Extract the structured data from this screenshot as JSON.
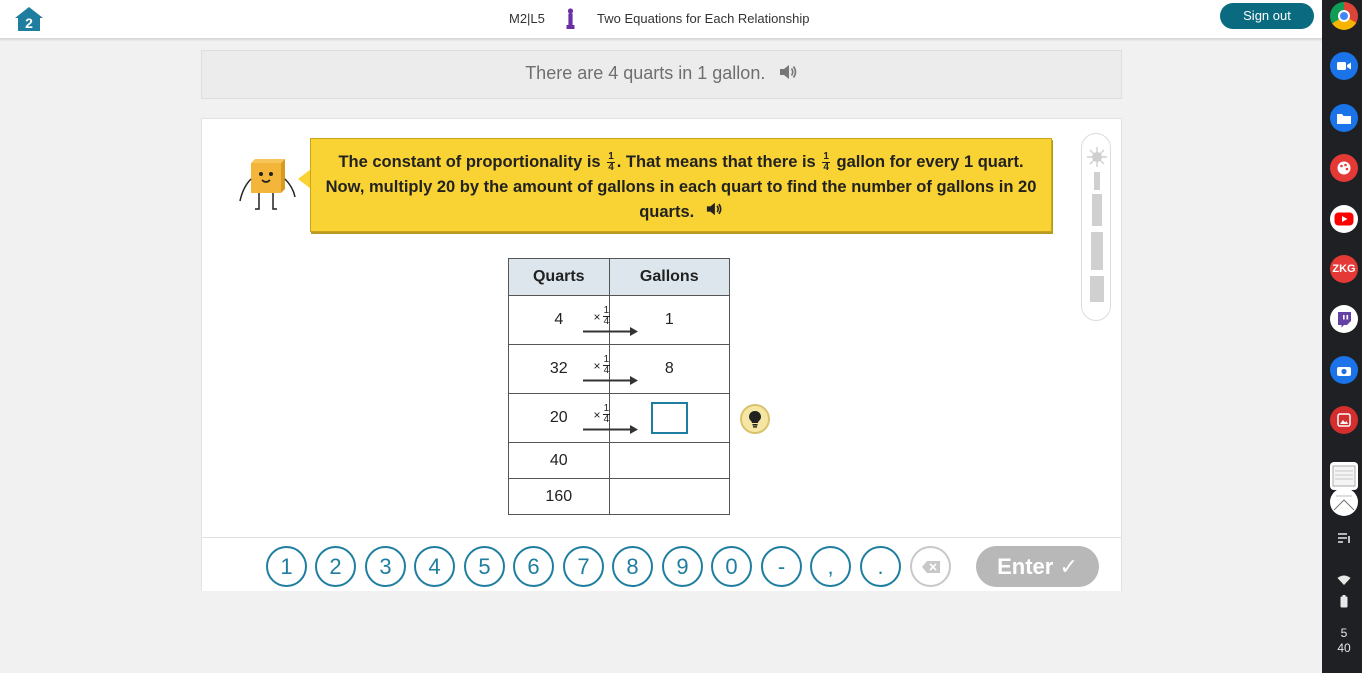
{
  "header": {
    "lesson_code": "M2|L5",
    "lesson_title": "Two Equations for Each Relationship",
    "signout_label": "Sign out",
    "accent_color": "#0a6a80"
  },
  "prompt": {
    "text": "There are 4 quarts in 1 gallon."
  },
  "hint": {
    "part1": "The constant of proportionality is",
    "frac1_num": "1",
    "frac1_den": "4",
    "part2": ". That means that there is",
    "frac2_num": "1",
    "frac2_den": "4",
    "part3": "gallon for every 1 quart. Now, multiply 20 by the amount of gallons in each quart to find the number of gallons in 20 quarts."
  },
  "table": {
    "headers": [
      "Quarts",
      "Gallons"
    ],
    "operator_symbol": "×",
    "operator_num": "1",
    "operator_den": "4",
    "rows": [
      {
        "quarts": "4",
        "gallons": "1"
      },
      {
        "quarts": "32",
        "gallons": "8"
      },
      {
        "quarts": "20",
        "gallons": ""
      },
      {
        "quarts": "40",
        "gallons": ""
      },
      {
        "quarts": "160",
        "gallons": ""
      }
    ]
  },
  "keypad": {
    "keys": [
      "1",
      "2",
      "3",
      "4",
      "5",
      "6",
      "7",
      "8",
      "9",
      "0",
      "-",
      ",",
      "."
    ],
    "enter_label": "Enter ✓"
  },
  "shelf": {
    "clock_hour": "5",
    "clock_minute": "40",
    "apps": [
      "chrome-icon",
      "video-call-icon",
      "files-icon",
      "paint-icon",
      "youtube-icon",
      "zkg-icon",
      "twitch-icon",
      "camera-icon",
      "gallery-icon"
    ],
    "zkg_label": "ZKG"
  }
}
